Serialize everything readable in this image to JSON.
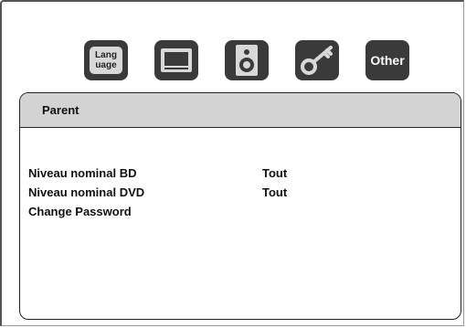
{
  "tabs": [
    {
      "name": "language",
      "label": "Lang\nuage",
      "icon": "language-icon"
    },
    {
      "name": "display",
      "label": "",
      "icon": "tv-screen-icon"
    },
    {
      "name": "audio",
      "label": "",
      "icon": "speaker-icon"
    },
    {
      "name": "parent",
      "label": "",
      "icon": "key-icon"
    },
    {
      "name": "other",
      "label": "Other",
      "icon": "other-icon"
    }
  ],
  "panel": {
    "title": "Parent"
  },
  "menu": {
    "items": [
      {
        "label": "Niveau nominal BD",
        "value": "Tout"
      },
      {
        "label": "Niveau nominal DVD",
        "value": "Tout"
      },
      {
        "label": "Change Password",
        "value": ""
      }
    ]
  },
  "colors": {
    "icon_bg": "#3a3a3a",
    "header_bg": "#d3d3d3",
    "text": "#111111"
  }
}
